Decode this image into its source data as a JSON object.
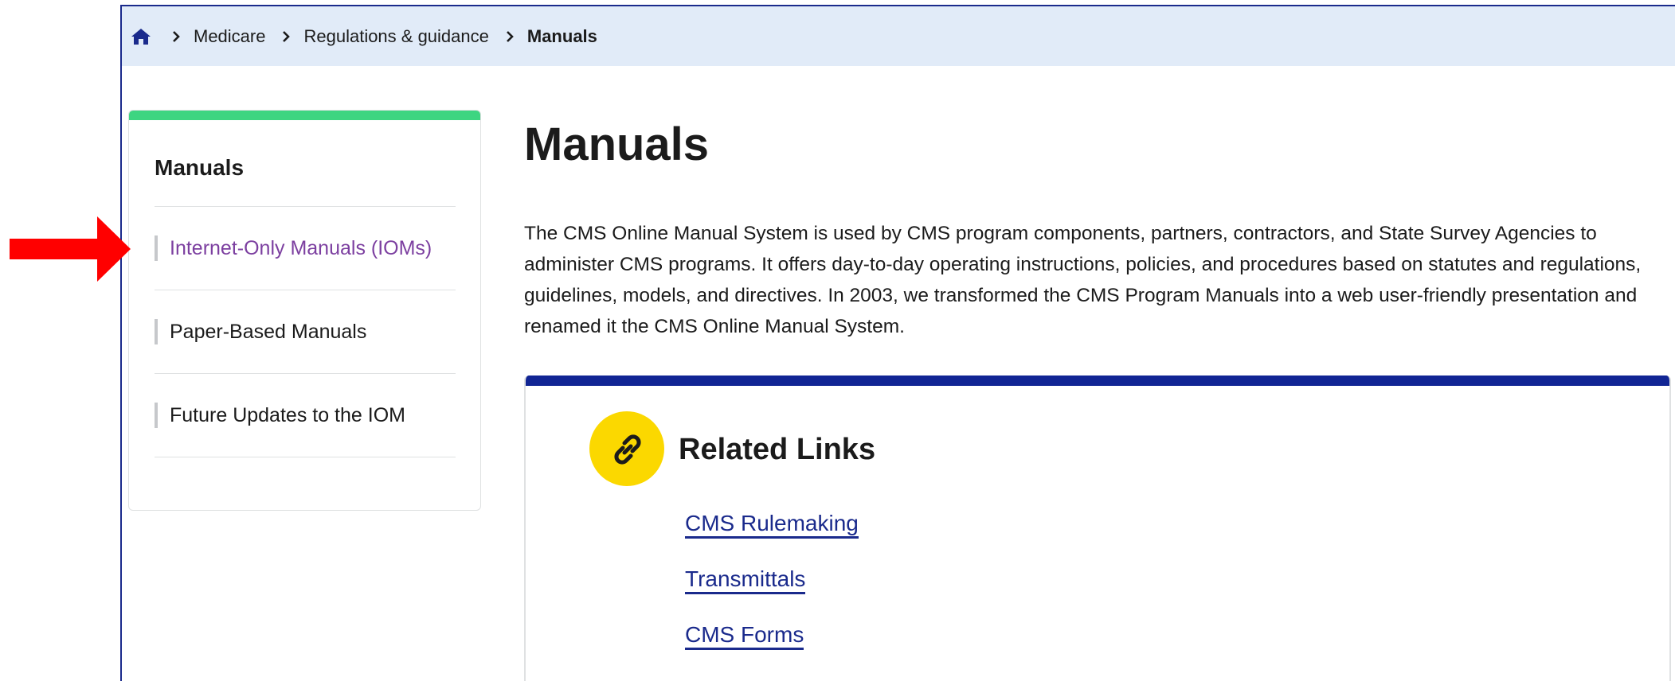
{
  "breadcrumb": {
    "home_icon": "home-icon",
    "items": [
      "Medicare",
      "Regulations & guidance"
    ],
    "current": "Manuals"
  },
  "sidebar": {
    "title": "Manuals",
    "items": [
      {
        "label": "Internet-Only Manuals (IOMs)",
        "active": true
      },
      {
        "label": "Paper-Based Manuals",
        "active": false
      },
      {
        "label": "Future Updates to the IOM",
        "active": false
      }
    ],
    "accent_color": "#3ed581"
  },
  "main": {
    "title": "Manuals",
    "intro": "The CMS Online Manual System is used by CMS program components, partners, contractors, and State Survey Agencies to administer CMS programs.  It offers day-to-day operating instructions, policies, and procedures based on statutes and regulations, guidelines, models, and directives.  In 2003, we transformed the CMS Program Manuals into a web user-friendly presentation and renamed it the CMS Online Manual System."
  },
  "related_links": {
    "title": "Related Links",
    "icon": "link-icon",
    "links": [
      "CMS Rulemaking",
      "Transmittals",
      "CMS Forms"
    ],
    "accent_color": "#112594",
    "icon_bg_color": "#fbd800"
  },
  "annotation": {
    "arrow_color": "#ff0000"
  }
}
